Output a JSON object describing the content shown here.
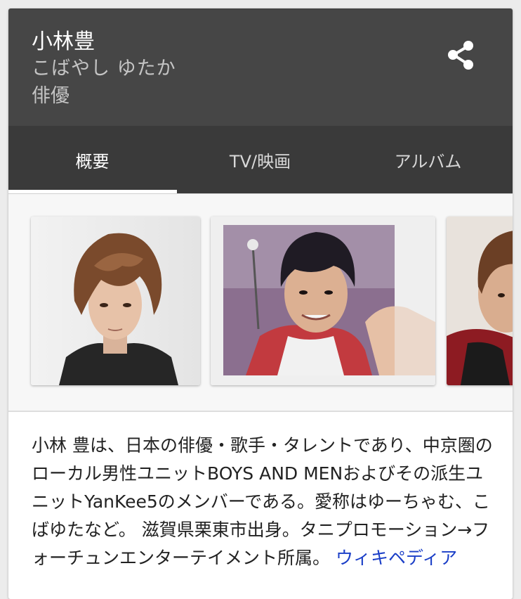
{
  "entity": {
    "name": "小林豊",
    "reading": "こばやし ゆたか",
    "category": "俳優"
  },
  "header": {
    "share_icon": "share-icon"
  },
  "tabs": [
    {
      "label": "概要",
      "active": true
    },
    {
      "label": "TV/映画",
      "active": false
    },
    {
      "label": "アルバム",
      "active": false
    }
  ],
  "colors": {
    "header_bg": "#464646",
    "tabs_bg": "#3a3a3a",
    "link": "#1a3ec7"
  },
  "description": {
    "text": "小林 豊は、日本の俳優・歌手・タレントであり、中京圏のローカル男性ユニットBOYS AND MENおよびその派生ユニットYanKee5のメンバーである。愛称はゆーちゃむ、こばゆたなど。 滋賀県栗東市出身。タニプロモーション→フォーチュンエンターテイメント所属。",
    "source_link": "ウィキペディア"
  }
}
